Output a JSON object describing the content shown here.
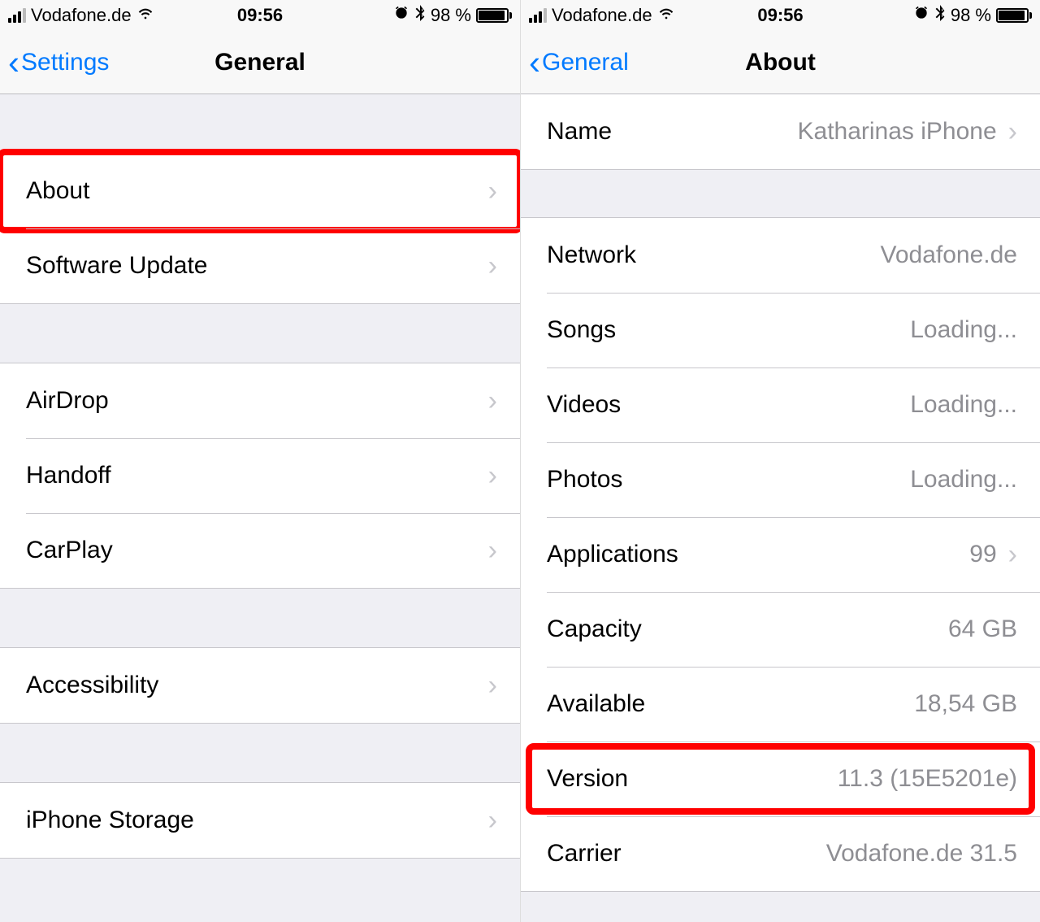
{
  "status": {
    "carrier": "Vodafone.de",
    "time": "09:56",
    "battery_pct": "98 %",
    "wifi_icon": "wifi",
    "alarm_icon": "alarm",
    "bluetooth_icon": "bluetooth"
  },
  "left_screen": {
    "back_label": "Settings",
    "title": "General",
    "groups": [
      {
        "rows": [
          {
            "label": "About",
            "value": "",
            "disclosure": true
          },
          {
            "label": "Software Update",
            "value": "",
            "disclosure": true
          }
        ]
      },
      {
        "rows": [
          {
            "label": "AirDrop",
            "value": "",
            "disclosure": true
          },
          {
            "label": "Handoff",
            "value": "",
            "disclosure": true
          },
          {
            "label": "CarPlay",
            "value": "",
            "disclosure": true
          }
        ]
      },
      {
        "rows": [
          {
            "label": "Accessibility",
            "value": "",
            "disclosure": true
          }
        ]
      },
      {
        "rows": [
          {
            "label": "iPhone Storage",
            "value": "",
            "disclosure": true
          }
        ]
      }
    ]
  },
  "right_screen": {
    "back_label": "General",
    "title": "About",
    "groups": [
      {
        "rows": [
          {
            "label": "Name",
            "value": "Katharinas iPhone",
            "disclosure": true
          }
        ]
      },
      {
        "rows": [
          {
            "label": "Network",
            "value": "Vodafone.de",
            "disclosure": false
          },
          {
            "label": "Songs",
            "value": "Loading...",
            "disclosure": false
          },
          {
            "label": "Videos",
            "value": "Loading...",
            "disclosure": false
          },
          {
            "label": "Photos",
            "value": "Loading...",
            "disclosure": false
          },
          {
            "label": "Applications",
            "value": "99",
            "disclosure": true
          },
          {
            "label": "Capacity",
            "value": "64 GB",
            "disclosure": false
          },
          {
            "label": "Available",
            "value": "18,54 GB",
            "disclosure": false
          },
          {
            "label": "Version",
            "value": "11.3 (15E5201e)",
            "disclosure": false
          },
          {
            "label": "Carrier",
            "value": "Vodafone.de 31.5",
            "disclosure": false
          }
        ]
      }
    ]
  }
}
